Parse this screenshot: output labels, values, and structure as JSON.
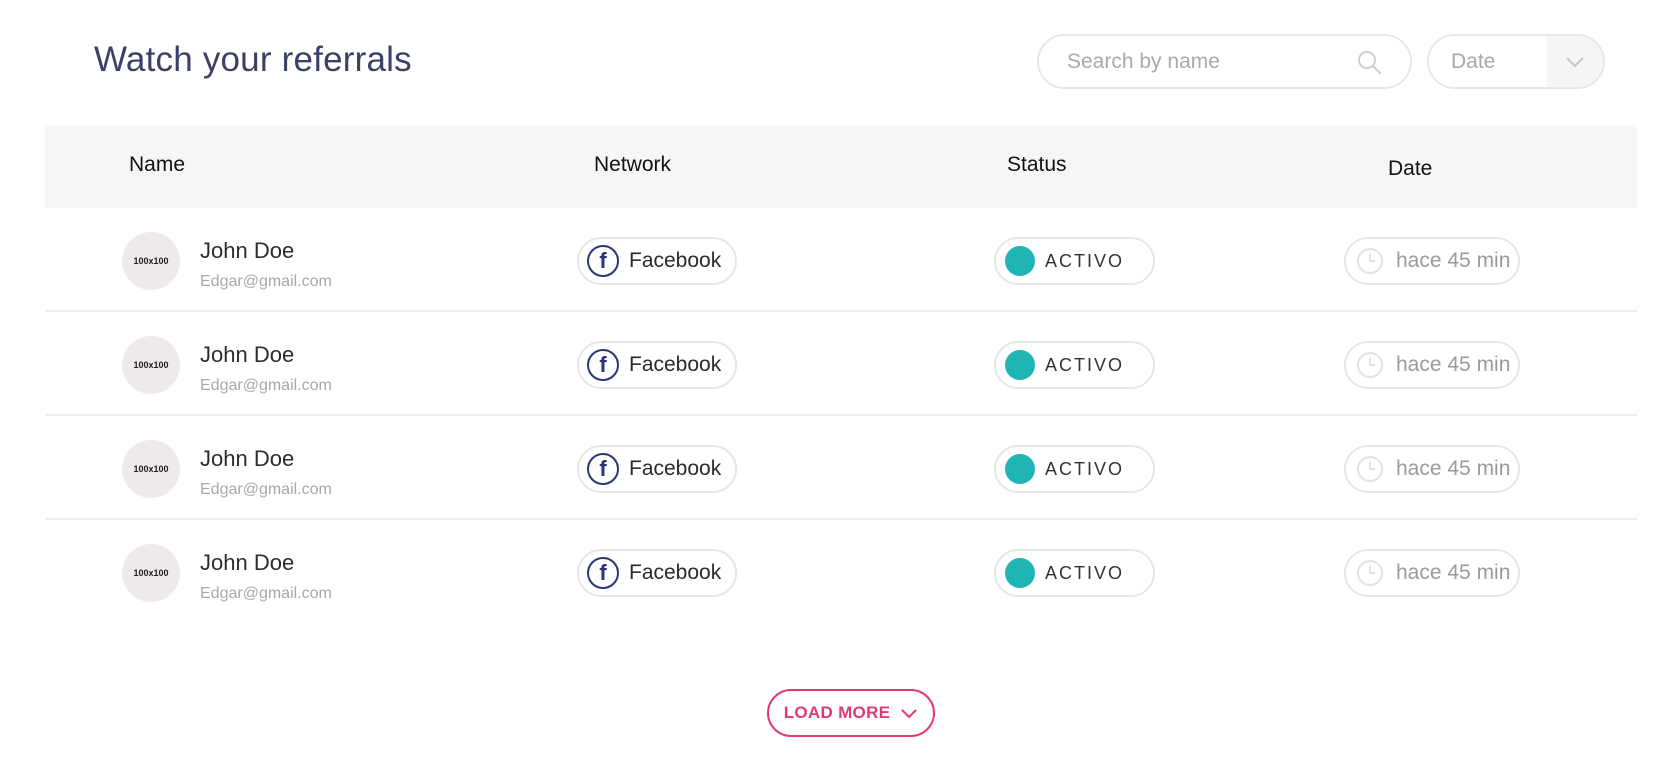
{
  "header": {
    "title": "Watch your referrals",
    "search_placeholder": "Search by name",
    "date_filter_label": "Date"
  },
  "table": {
    "columns": [
      "Name",
      "Network",
      "Status",
      "Date"
    ],
    "rows": [
      {
        "avatar": "100x100",
        "name": "John Doe",
        "email": "Edgar@gmail.com",
        "network": "Facebook",
        "status": "ACTIVO",
        "time": "hace 45 min"
      },
      {
        "avatar": "100x100",
        "name": "John Doe",
        "email": "Edgar@gmail.com",
        "network": "Facebook",
        "status": "ACTIVO",
        "time": "hace 45 min"
      },
      {
        "avatar": "100x100",
        "name": "John Doe",
        "email": "Edgar@gmail.com",
        "network": "Facebook",
        "status": "ACTIVO",
        "time": "hace 45 min"
      },
      {
        "avatar": "100x100",
        "name": "John Doe",
        "email": "Edgar@gmail.com",
        "network": "Facebook",
        "status": "ACTIVO",
        "time": "hace 45 min"
      }
    ]
  },
  "load_more": {
    "label": "LOAD MORE"
  },
  "colors": {
    "title": "#3a4166",
    "status_active": "#1fb5b5",
    "facebook": "#283673",
    "accent": "#e33a6e"
  },
  "icons": {
    "search": "search-icon",
    "date_caret": "chevron-down-icon",
    "network": "facebook-icon",
    "status": "status-dot-icon",
    "time": "clock-icon",
    "load_more": "chevron-down-icon"
  }
}
